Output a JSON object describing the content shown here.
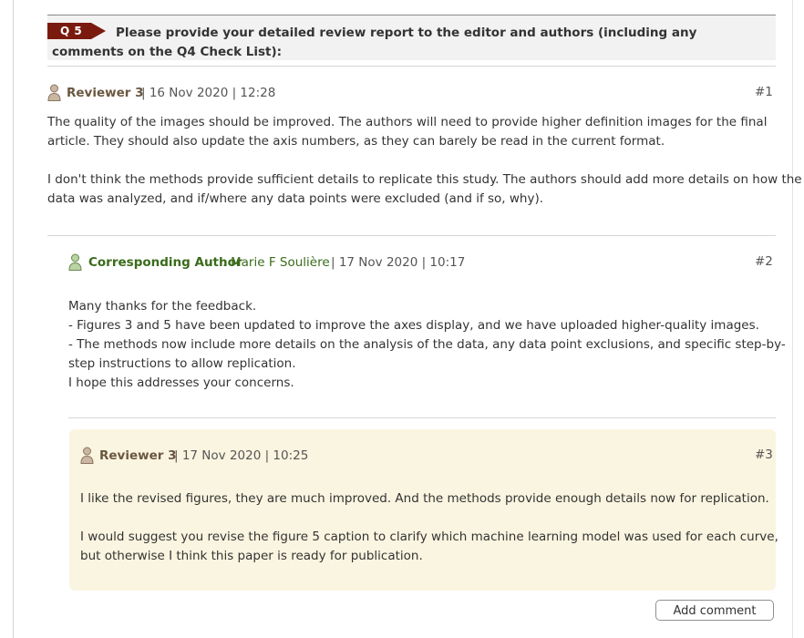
{
  "question": {
    "badge": "Q 5",
    "title": "Please provide your detailed review report to the editor and authors (including any comments on the Q4 Check List):"
  },
  "comments": [
    {
      "author": "Reviewer 3",
      "meta": "| 16 Nov 2020 | 12:28",
      "number": "#1",
      "paragraphs": [
        [
          "The quality of the images should be improved. The authors will need to provide higher definition images for the final",
          "article. They should also update the axis numbers, as they can barely be read in the current format."
        ],
        [
          "I don't think the methods provide sufficient details to replicate this study. The authors should add more details on how the",
          "data was analyzed, and if/where any data points were excluded (and if so, why)."
        ]
      ]
    },
    {
      "author_role": "Corresponding Author",
      "author_sep": ":",
      "author_name": "Marie F Soulière",
      "meta": "| 17 Nov 2020 | 10:17",
      "number": "#2",
      "lines": [
        "Many thanks for the feedback.",
        "- Figures 3 and 5 have been updated to improve the axes display, and we have uploaded higher-quality images.",
        "- The methods now include more details on the analysis of the data, any data point exclusions, and specific step-by-",
        "step instructions to allow replication.",
        "I hope this addresses your concerns."
      ]
    },
    {
      "author": "Reviewer 3",
      "meta": "| 17 Nov 2020 | 10:25",
      "number": "#3",
      "paragraphs": [
        [
          "I like the revised figures, they are much improved. And the methods provide enough details now for replication."
        ],
        [
          "I would suggest you revise the figure 5 caption to clarify which machine learning model was used for each curve,",
          "but otherwise I think this paper is ready for publication."
        ]
      ]
    }
  ],
  "actions": {
    "add_comment": "Add comment"
  },
  "icons": {
    "reviewer": "person-icon",
    "author": "person-icon"
  },
  "colors": {
    "badge": "#7a1a0f",
    "reviewer_name": "#6b5740",
    "author_name": "#3a6b1a",
    "reply_bg": "#faf5e0"
  }
}
